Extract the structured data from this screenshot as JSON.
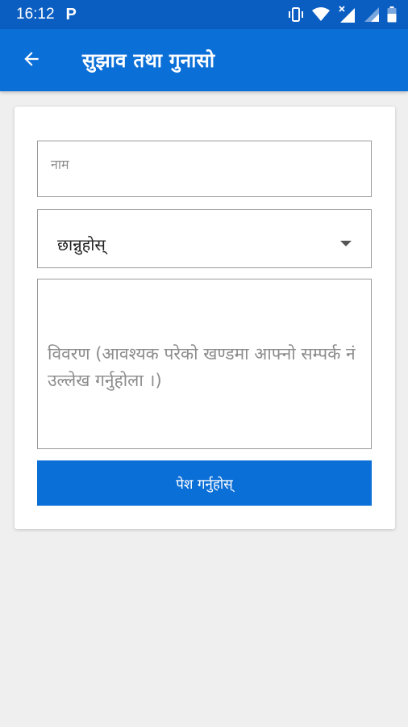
{
  "status_bar": {
    "time": "16:12",
    "notification_letter": "P",
    "icons": [
      "vibrate-icon",
      "wifi-icon",
      "signal-no-service-icon",
      "signal-icon",
      "battery-icon"
    ]
  },
  "app_bar": {
    "title": "सुझाव तथा गुनासो",
    "back_icon": "arrow-left-icon"
  },
  "form": {
    "name_placeholder": "नाम",
    "name_value": "",
    "category_selected": "छान्नुहोस्",
    "description_placeholder": "विवरण (आवश्यक परेको खण्डमा आफ्नो सम्पर्क नं उल्लेख गर्नुहोला ।)",
    "description_value": "",
    "submit_label": "पेश गर्नुहोस्"
  },
  "colors": {
    "status_bar": "#0a5ec2",
    "app_bar": "#0b6fd8",
    "button": "#0b6fd8",
    "background": "#efefef"
  }
}
